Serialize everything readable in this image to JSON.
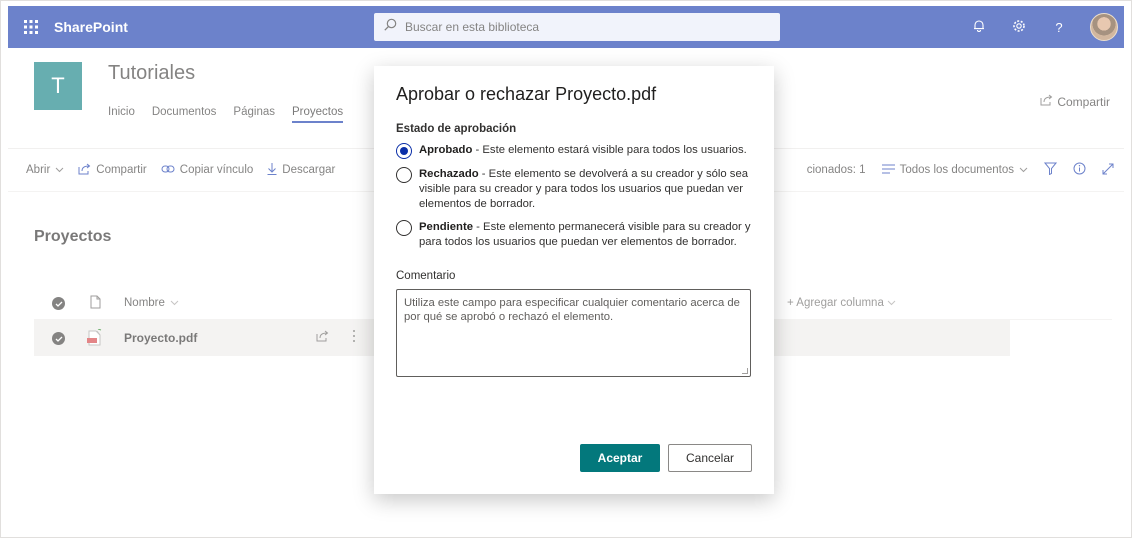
{
  "suitebar": {
    "app_name": "SharePoint",
    "search_placeholder": "Buscar en esta biblioteca",
    "icons": [
      "waffle-icon",
      "search-icon",
      "bell-icon",
      "gear-icon",
      "help-icon",
      "avatar"
    ],
    "help_glyph": "?"
  },
  "site": {
    "logo_letter": "T",
    "title": "Tutoriales",
    "nav": [
      "Inicio",
      "Documentos",
      "Páginas",
      "Proyectos"
    ],
    "share_label": "Compartir"
  },
  "commandbar": {
    "left": [
      "Abrir",
      "Compartir",
      "Copiar vínculo",
      "Descargar"
    ],
    "selected_label": "cionados: 1",
    "view_label": "Todos los documentos"
  },
  "list": {
    "title": "Proyectos",
    "columns": {
      "name": "Nombre",
      "add_column": "+ Agregar columna"
    },
    "rows": [
      {
        "name": "Proyecto.pdf"
      }
    ]
  },
  "dialog": {
    "title": "Aprobar o rechazar Proyecto.pdf",
    "status_label": "Estado de aprobación",
    "options": [
      {
        "title": "Aprobado",
        "desc": " - Este elemento estará visible para todos los usuarios.",
        "selected": true
      },
      {
        "title": "Rechazado",
        "desc": " - Este elemento se devolverá a su creador y sólo sea visible para su creador y para todos los usuarios que puedan ver elementos de borrador.",
        "selected": false
      },
      {
        "title": "Pendiente",
        "desc": " - Este elemento permanecerá visible para su creador y para todos los usuarios que puedan ver elementos de borrador.",
        "selected": false
      }
    ],
    "comment_label": "Comentario",
    "comment_placeholder": "Utiliza este campo para especificar cualquier comentario acerca de por qué se aprobó o rechazó el elemento.",
    "accept_label": "Aceptar",
    "cancel_label": "Cancelar"
  },
  "colors": {
    "suitebar": "#0b2fa8",
    "accent_teal": "#03787c"
  }
}
